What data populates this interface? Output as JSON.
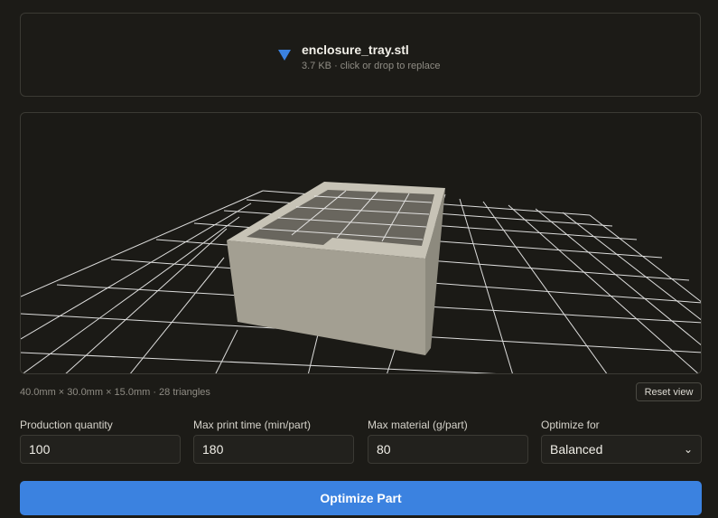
{
  "upload": {
    "file_name": "enclosure_tray.stl",
    "meta": "3.7 KB · click or drop to replace",
    "icon": "triangle-down-icon"
  },
  "viewer": {
    "dimensions": "40.0mm × 30.0mm × 15.0mm · 28 triangles",
    "reset_label": "Reset view",
    "model_color": "#a39f92",
    "grid_color": "#ffffff"
  },
  "form": {
    "quantity_label": "Production quantity",
    "quantity_value": "100",
    "time_label": "Max print time (min/part)",
    "time_value": "180",
    "material_label": "Max material (g/part)",
    "material_value": "80",
    "optimize_label": "Optimize for",
    "optimize_value": "Balanced"
  },
  "cta_label": "Optimize Part",
  "accent_color": "#3b82e0"
}
